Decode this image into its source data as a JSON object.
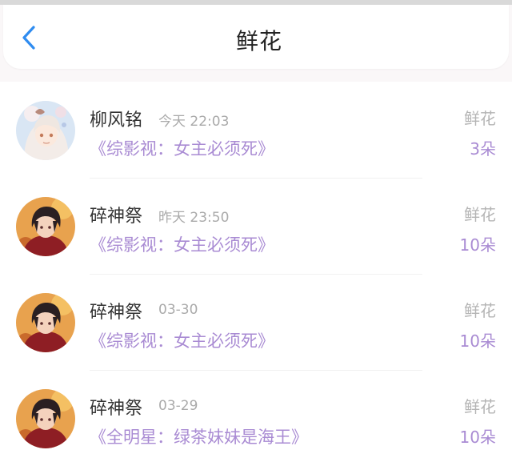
{
  "header": {
    "title": "鲜花",
    "back_icon": "chevron-left-icon",
    "accent_color": "#2f8cf0"
  },
  "records": [
    {
      "user": "柳风铭",
      "time": "今天 22:03",
      "book": "《综影视：女主必须死》",
      "gift": "鲜花",
      "count": "3朵",
      "avatar": "anime-girl-avatar"
    },
    {
      "user": "碎神祭",
      "time": "昨天 23:50",
      "book": "《综影视：女主必须死》",
      "gift": "鲜花",
      "count": "10朵",
      "avatar": "anime-boy-avatar"
    },
    {
      "user": "碎神祭",
      "time": "03-30",
      "book": "《综影视：女主必须死》",
      "gift": "鲜花",
      "count": "10朵",
      "avatar": "anime-boy-avatar"
    },
    {
      "user": "碎神祭",
      "time": "03-29",
      "book": "《全明星：绿茶妹妹是海王》",
      "gift": "鲜花",
      "count": "10朵",
      "avatar": "anime-boy-avatar"
    }
  ],
  "colors": {
    "book_title": "#a98bd3",
    "secondary_text": "#aaaaaa"
  }
}
